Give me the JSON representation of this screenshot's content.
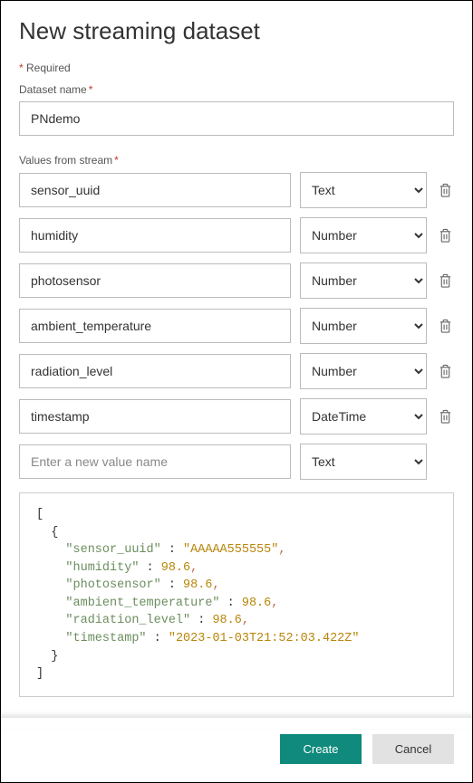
{
  "title": "New streaming dataset",
  "required_label": "* Required",
  "dataset_name_label": "Dataset name",
  "dataset_name_value": "PNdemo",
  "values_label": "Values from stream",
  "type_options": [
    "Text",
    "Number",
    "DateTime"
  ],
  "rows": [
    {
      "name": "sensor_uuid",
      "type": "Text"
    },
    {
      "name": "humidity",
      "type": "Number"
    },
    {
      "name": "photosensor",
      "type": "Number"
    },
    {
      "name": "ambient_temperature",
      "type": "Number"
    },
    {
      "name": "radiation_level",
      "type": "Number"
    },
    {
      "name": "timestamp",
      "type": "DateTime"
    }
  ],
  "new_row": {
    "placeholder": "Enter a new value name",
    "type": "Text"
  },
  "preview": {
    "sensor_uuid": "AAAAA555555",
    "humidity": 98.6,
    "photosensor": 98.6,
    "ambient_temperature": 98.6,
    "radiation_level": 98.6,
    "timestamp": "2023-01-03T21:52:03.422Z"
  },
  "buttons": {
    "create": "Create",
    "cancel": "Cancel"
  }
}
